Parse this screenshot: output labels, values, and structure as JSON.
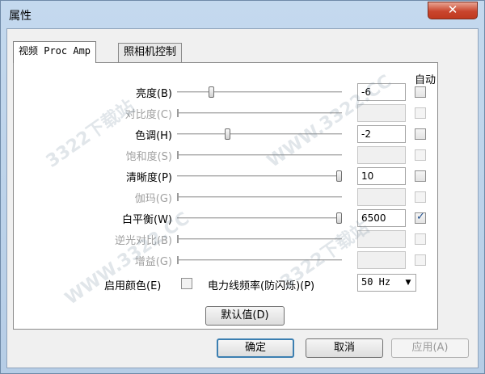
{
  "window": {
    "title": "属性",
    "close_label": "✕"
  },
  "tabs": [
    {
      "label": "视频 Proc Amp",
      "active": true
    },
    {
      "label": "照相机控制",
      "active": false
    }
  ],
  "auto_header": "自动",
  "properties": [
    {
      "label": "亮度(B)",
      "value": "-6",
      "enabled": true,
      "auto": false,
      "level": 0.2
    },
    {
      "label": "对比度(C)",
      "value": "",
      "enabled": false,
      "auto": false
    },
    {
      "label": "色调(H)",
      "value": "-2",
      "enabled": true,
      "auto": false,
      "level": 0.3
    },
    {
      "label": "饱和度(S)",
      "value": "",
      "enabled": false,
      "auto": false
    },
    {
      "label": "清晰度(P)",
      "value": "10",
      "enabled": true,
      "auto": false,
      "level": 1.0
    },
    {
      "label": "伽玛(G)",
      "value": "",
      "enabled": false,
      "auto": false
    },
    {
      "label": "白平衡(W)",
      "value": "6500",
      "enabled": true,
      "auto": true,
      "level": 1.0
    },
    {
      "label": "逆光对比(B)",
      "value": "",
      "enabled": false,
      "auto": false
    },
    {
      "label": "增益(G)",
      "value": "",
      "enabled": false,
      "auto": false
    }
  ],
  "color_enable_label": "启用颜色(E)",
  "powerline_label": "电力线频率(防闪烁)(P)",
  "powerline_value": "50 Hz",
  "default_button": "默认值(D)",
  "buttons": {
    "ok": "确定",
    "cancel": "取消",
    "apply": "应用(A)"
  },
  "watermark": "WWW.3322.CC",
  "watermark_cn": "3322下载站"
}
